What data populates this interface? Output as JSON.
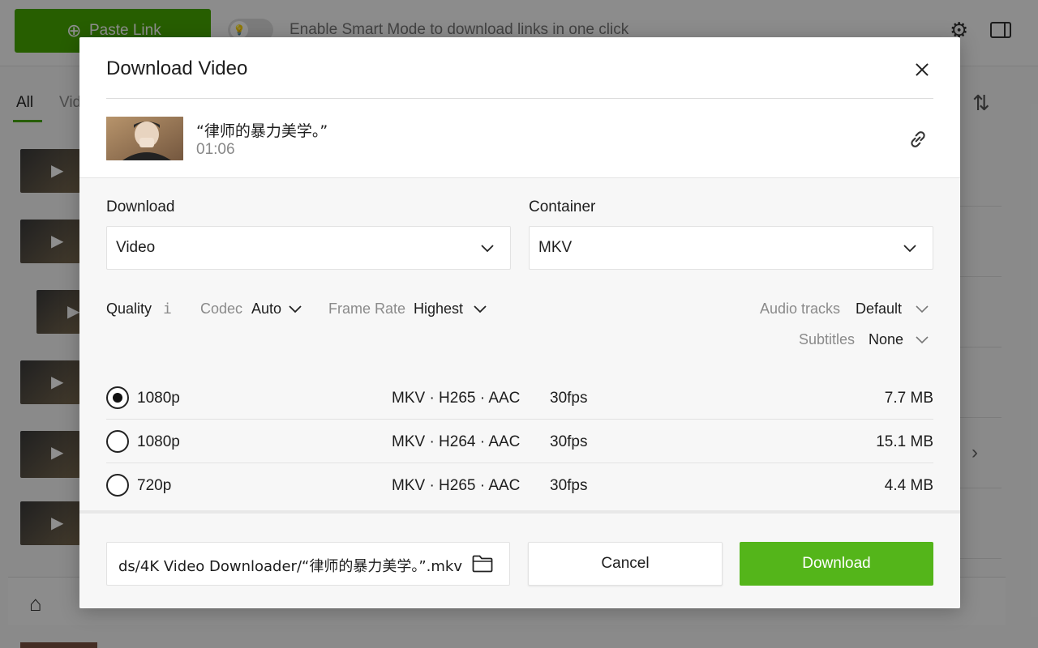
{
  "background": {
    "paste_link_label": "Paste Link",
    "smart_mode_text": "Enable Smart Mode to download links in one click",
    "tabs": [
      {
        "label": "All"
      },
      {
        "label": "Vid"
      }
    ]
  },
  "dialog": {
    "title": "Download Video",
    "video": {
      "title": "“律师的暴力美学。”",
      "duration": "01:06"
    },
    "download_field": {
      "label": "Download",
      "value": "Video"
    },
    "container_field": {
      "label": "Container",
      "value": "MKV"
    },
    "quality_label": "Quality",
    "quality_info": "i",
    "codec": {
      "label": "Codec",
      "value": "Auto"
    },
    "frame_rate": {
      "label": "Frame Rate",
      "value": "Highest"
    },
    "audio_tracks": {
      "label": "Audio tracks",
      "value": "Default"
    },
    "subtitles": {
      "label": "Subtitles",
      "value": "None"
    },
    "options": [
      {
        "resolution": "1080p",
        "format": "MKV · H265 · AAC",
        "fps": "30fps",
        "size": "7.7 MB",
        "selected": true
      },
      {
        "resolution": "1080p",
        "format": "MKV · H264 · AAC",
        "fps": "30fps",
        "size": "15.1 MB",
        "selected": false
      },
      {
        "resolution": "720p",
        "format": "MKV · H265 · AAC",
        "fps": "30fps",
        "size": "4.4 MB",
        "selected": false
      }
    ],
    "save_path": "ds/4K Video Downloader/“律师的暴力美学。”.mkv",
    "cancel_label": "Cancel",
    "download_label": "Download"
  },
  "colors": {
    "accent_green": "#54b51a",
    "overlay": "rgba(0,0,0,0.44)"
  }
}
